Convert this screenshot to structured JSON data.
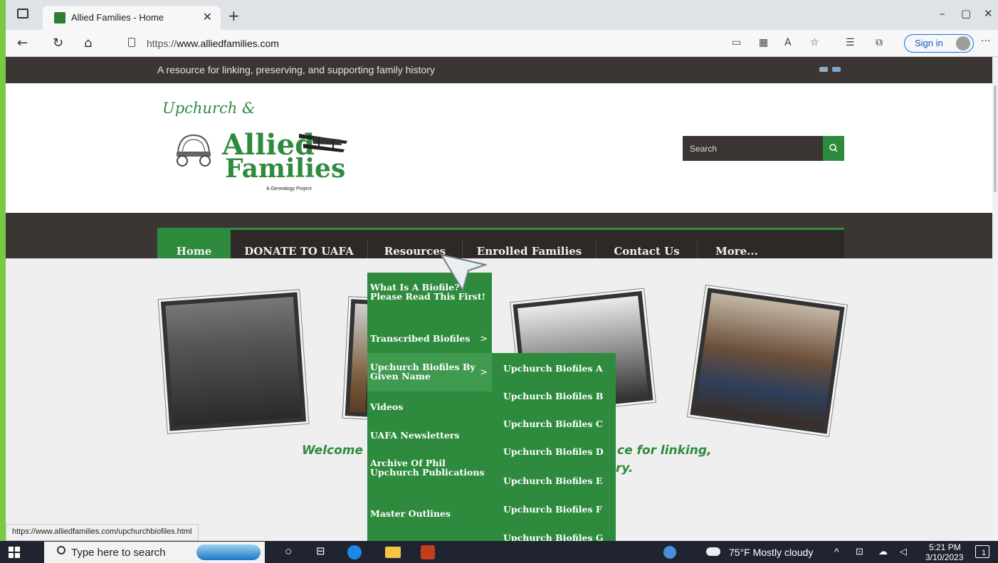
{
  "browser": {
    "tab_title": "Allied Families - Home",
    "new_tab": "+",
    "url_prefix": "https://",
    "url_host": "www.alliedfamilies.com",
    "sign_in": "Sign in",
    "more": "···",
    "window_controls": [
      "–",
      "▢",
      "✕"
    ]
  },
  "site": {
    "tagline": "A resource for linking, preserving, and supporting family history",
    "logo": {
      "line1": "Upchurch &",
      "line2": "Allied",
      "line3": "Families",
      "line4": "A Genealogy Project"
    },
    "search_placeholder": "Search"
  },
  "nav": {
    "items": [
      "Home",
      "DONATE TO UAFA",
      "Resources",
      "Enrolled Families",
      "Contact Us",
      "More..."
    ],
    "active_index": 0
  },
  "resources_menu": {
    "items": [
      "What Is A Biofile? Please Read This First!",
      "Transcribed Biofiles",
      "Upchurch Biofiles By Given Name",
      "Videos",
      "UAFA Newsletters",
      "Archive Of Phil Upchurch Publications",
      "Master Outlines"
    ],
    "highlighted_index": 2,
    "submenu_arrow": ">"
  },
  "biofiles_submenu": {
    "items": [
      "Upchurch Biofiles A",
      "Upchurch Biofiles B",
      "Upchurch Biofiles C",
      "Upchurch Biofiles D",
      "Upchurch Biofiles E",
      "Upchurch Biofiles F",
      "Upchurch Biofiles G"
    ]
  },
  "welcome": {
    "left": "Welcome t",
    "right1": "ce for linking,",
    "right2": "ry."
  },
  "status_bar": "https://www.alliedfamilies.com/upchurchbiofiles.html",
  "taskbar": {
    "search_placeholder": "Type here to search",
    "weather": "75°F  Mostly cloudy",
    "time": "5:21 PM",
    "date": "3/10/2023",
    "notifications": "1"
  },
  "colors": {
    "brand_green": "#2e8b3e",
    "dark_brown": "#3b3533"
  }
}
